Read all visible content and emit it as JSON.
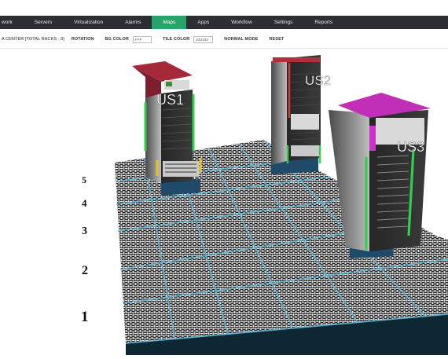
{
  "nav": {
    "items": [
      "work",
      "Servers",
      "Virtualization",
      "Alarms",
      "Maps",
      "Apps",
      "Workflow",
      "Settings",
      "Reports"
    ],
    "active": "Maps"
  },
  "toolbar": {
    "center_label": "A CENTER [TOTAL RACKS : 3]",
    "rotation_label": "ROTATION",
    "bg_color_label": "BG COLOR",
    "bg_color_value": "FFF",
    "tile_color_label": "TILE COLOR",
    "tile_color_value": "333333",
    "normal_mode_label": "NORMAL MODE",
    "reset_label": "RESET"
  },
  "racks": [
    {
      "label": "US1",
      "top_color": "#a6293a",
      "accent": "#2fd14a",
      "secondary": "#e8c120"
    },
    {
      "label": "US2",
      "top_color": "#b2303b",
      "accent": "#2fd14a",
      "secondary": "#d63a3a"
    },
    {
      "label": "US3",
      "top_color": "#c02fb6",
      "accent": "#2fd14a",
      "secondary": "#cc33cc"
    }
  ],
  "floor_labels": [
    "5",
    "4",
    "3",
    "2",
    "1"
  ],
  "colors": {
    "navbar": "#2b2e33",
    "nav_active": "#27a46a",
    "floor_edge": "#0e2833",
    "tile_grout": "#5fb7d8"
  }
}
